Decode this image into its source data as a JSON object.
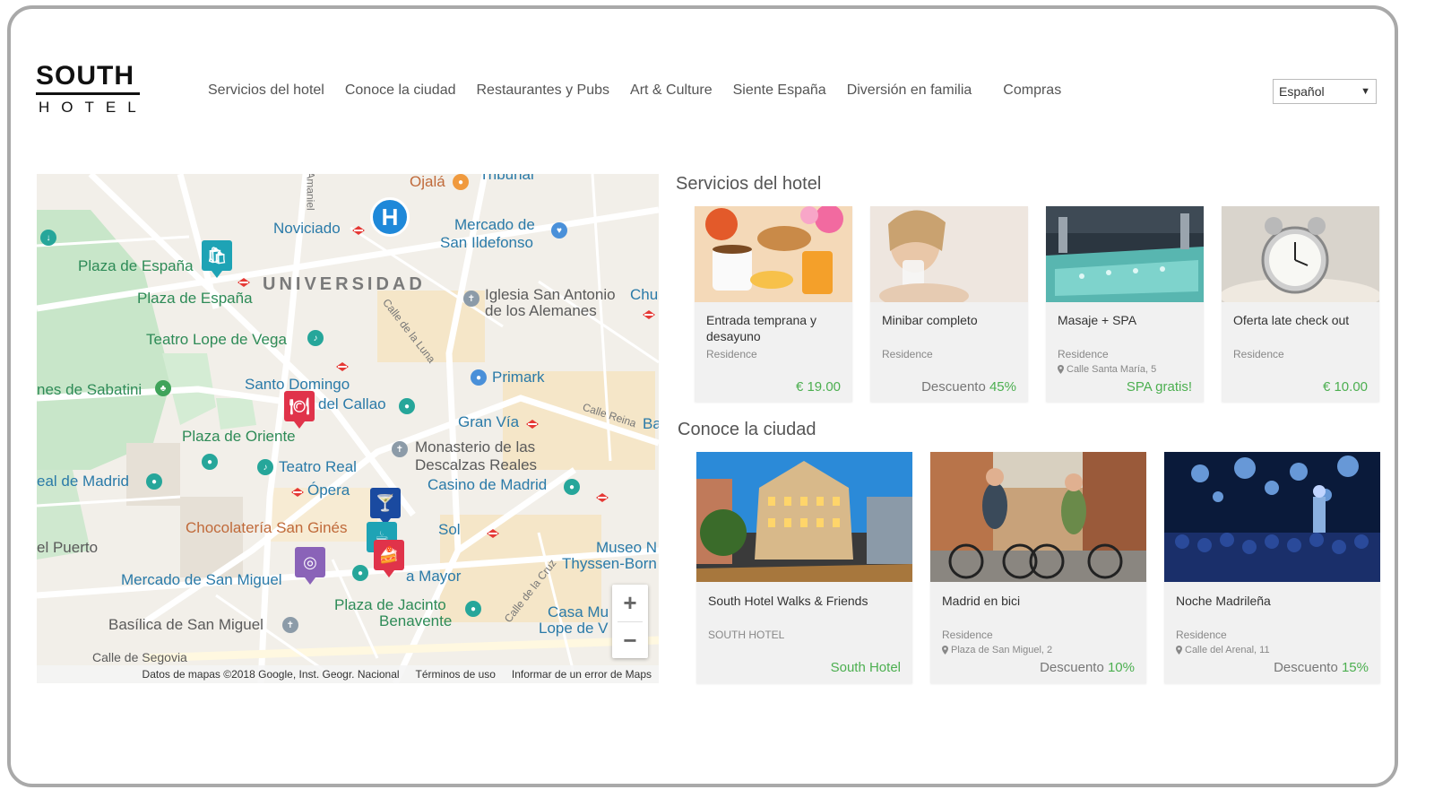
{
  "logo": {
    "top": "SOUTH",
    "bottom": "HOTEL"
  },
  "nav": [
    "Servicios del hotel",
    "Conoce la ciudad",
    "Restaurantes y Pubs",
    "Art & Culture",
    "Siente España",
    "Diversión en familia",
    "Compras"
  ],
  "language": {
    "selected": "Español"
  },
  "map": {
    "labels": {
      "ojala": "Ojalá",
      "tribunal": "Tribunal",
      "noviciado": "Noviciado",
      "mercado_ildefonso_1": "Mercado de",
      "mercado_ildefonso_2": "San Ildefonso",
      "plaza_espana_1": "Plaza de España",
      "plaza_espana_2": "Plaza de España",
      "universidad": "UNIVERSIDAD",
      "iglesia_1": "Iglesia San Antonio",
      "iglesia_2": "de los Alemanes",
      "chu": "Chu",
      "teatro_lope": "Teatro Lope de Vega",
      "primark": "Primark",
      "jardines": "nes de Sabatini",
      "santo_domingo": "Santo Domingo",
      "callao": "del Callao",
      "gran_via": "Gran Vía",
      "plaza_oriente": "Plaza de Oriente",
      "monasterio_1": "Monasterio de las",
      "monasterio_2": "Descalzas Reales",
      "teatro_real": "Teatro Real",
      "real_madrid": "eal de Madrid",
      "opera": "Ópera",
      "casino": "Casino de Madrid",
      "chocolateria": "Chocolatería San Ginés",
      "sol": "Sol",
      "puerto": "el Puerto",
      "museo_1": "Museo N",
      "museo_2": "Thyssen-Born",
      "mercado_san_miguel": "Mercado de San Miguel",
      "mayor": "a Mayor",
      "plaza_jacinto_1": "Plaza de Jacinto",
      "plaza_jacinto_2": "Benavente",
      "casa_1": "Casa Mu",
      "casa_2": "Lope de V",
      "basilica": "Basílica de San Miguel",
      "segovia": "Calle de Segovia",
      "calle_luna": "Calle de la Luna",
      "calle_reina": "Calle Reina",
      "calle_cruz": "Calle de la Cruz",
      "amaniel": "Amaniel",
      "ba": "Ba"
    },
    "hotel_marker": "H",
    "zoom_in": "+",
    "zoom_out": "−",
    "footer": [
      "Datos de mapas ©2018 Google, Inst. Geogr. Nacional",
      "Términos de uso",
      "Informar de un error de Maps"
    ]
  },
  "services": {
    "title": "Servicios del hotel",
    "cards": [
      {
        "title": "Entrada temprana y desayuno",
        "subtitle": "Residence",
        "address": "",
        "price_label": "",
        "price": "€ 19.00"
      },
      {
        "title": "Minibar completo",
        "subtitle": "Residence",
        "address": "",
        "price_label": "Descuento",
        "price": "45%"
      },
      {
        "title": "Masaje + SPA",
        "subtitle": "Residence",
        "address": "Calle Santa María, 5",
        "price_label": "",
        "price": "SPA gratis!"
      },
      {
        "title": "Oferta late check out",
        "subtitle": "Residence",
        "address": "",
        "price_label": "",
        "price": "€ 10.00"
      }
    ]
  },
  "city": {
    "title": "Conoce la ciudad",
    "cards": [
      {
        "title": "South Hotel Walks & Friends",
        "subtitle": "SOUTH HOTEL",
        "address": "",
        "price_label": "",
        "price": "South Hotel"
      },
      {
        "title": "Madrid en bici",
        "subtitle": "Residence",
        "address": "Plaza de San Miguel, 2",
        "price_label": "Descuento",
        "price": "10%"
      },
      {
        "title": "Noche Madrileña",
        "subtitle": "Residence",
        "address": "Calle del Arenal, 11",
        "price_label": "Descuento",
        "price": "15%"
      }
    ]
  },
  "colors": {
    "accent_green": "#4caf50",
    "map_bg": "#f2efe9",
    "hotel_pin": "#1e88d9"
  }
}
